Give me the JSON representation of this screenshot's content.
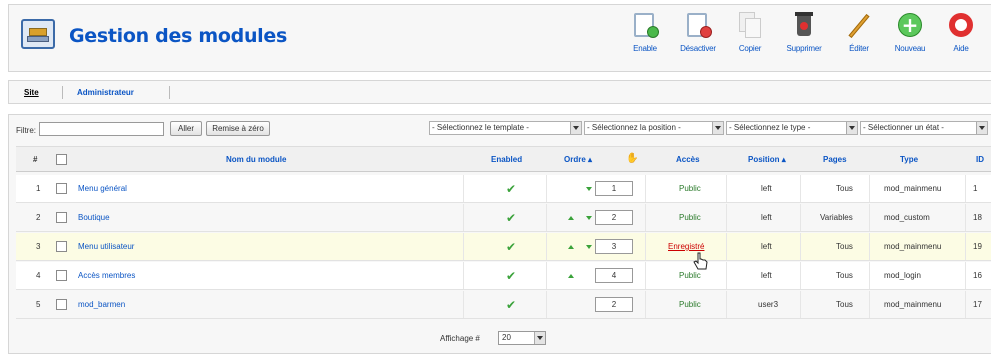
{
  "header": {
    "title": "Gestion des modules",
    "toolbar": [
      {
        "label": "Enable",
        "icon": "enable-icon"
      },
      {
        "label": "Désactiver",
        "icon": "disable-icon"
      },
      {
        "label": "Copier",
        "icon": "copy-icon"
      },
      {
        "label": "Supprimer",
        "icon": "trash-icon"
      },
      {
        "label": "Éditer",
        "icon": "edit-icon"
      },
      {
        "label": "Nouveau",
        "icon": "new-icon"
      },
      {
        "label": "Aide",
        "icon": "help-icon"
      }
    ]
  },
  "submenu": {
    "items": [
      {
        "label": "Site",
        "active": true
      },
      {
        "label": "Administrateur",
        "active": false
      }
    ]
  },
  "filter": {
    "label": "Filtre:",
    "value": "",
    "go_label": "Aller",
    "reset_label": "Remise à zéro",
    "selects": [
      "- Sélectionnez le template -",
      "- Sélectionnez la position -",
      "- Sélectionnez le type -",
      "- Sélectionner un état -"
    ]
  },
  "table": {
    "columns": {
      "num": "#",
      "name": "Nom du module",
      "enabled": "Enabled",
      "order": "Ordre",
      "access": "Accès",
      "position": "Position",
      "pages": "Pages",
      "type": "Type",
      "id": "ID"
    },
    "rows": [
      {
        "num": "1",
        "name": "Menu général",
        "order": "1",
        "access": "Public",
        "position": "left",
        "pages": "Tous",
        "type": "mod_mainmenu",
        "id": "1"
      },
      {
        "num": "2",
        "name": "Boutique",
        "order": "2",
        "access": "Public",
        "position": "left",
        "pages": "Variables",
        "type": "mod_custom",
        "id": "18"
      },
      {
        "num": "3",
        "name": "Menu utilisateur",
        "order": "3",
        "access": "Enregistré",
        "position": "left",
        "pages": "Tous",
        "type": "mod_mainmenu",
        "id": "19"
      },
      {
        "num": "4",
        "name": "Accès membres",
        "order": "4",
        "access": "Public",
        "position": "left",
        "pages": "Tous",
        "type": "mod_login",
        "id": "16"
      },
      {
        "num": "5",
        "name": "mod_barmen",
        "order": "2",
        "access": "Public",
        "position": "user3",
        "pages": "Tous",
        "type": "mod_mainmenu",
        "id": "17"
      }
    ]
  },
  "footer": {
    "label": "Affichage #",
    "value": "20"
  },
  "colors": {
    "link": "#0b55c4",
    "enabled_check": "#3aa23a",
    "highlight_row": "#fcfce4",
    "registered_access": "#cc0000"
  }
}
